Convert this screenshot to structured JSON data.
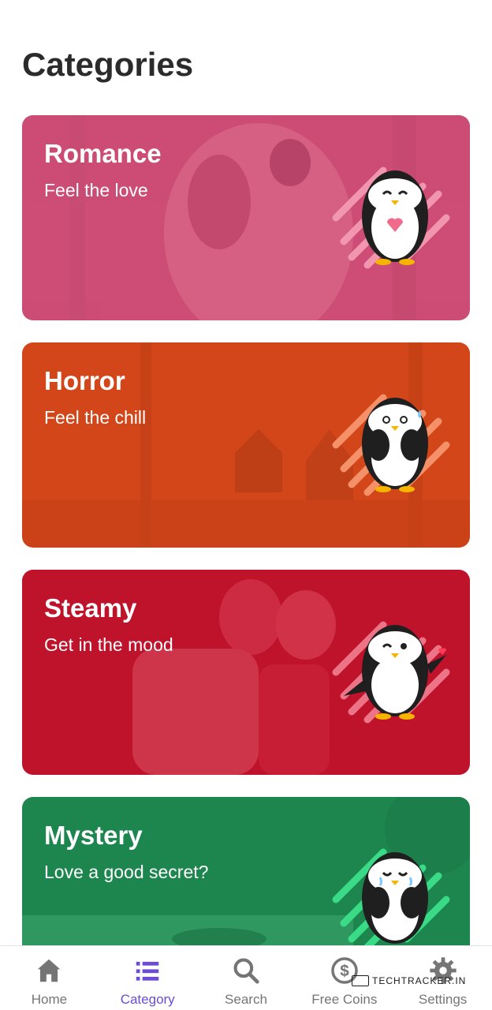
{
  "page": {
    "title": "Categories"
  },
  "categories": [
    {
      "title": "Romance",
      "subtitle": "Feel the love",
      "color": "#d2527a",
      "accent": "#f08aa8"
    },
    {
      "title": "Horror",
      "subtitle": "Feel the chill",
      "color": "#d94a1e",
      "accent": "#f07a52"
    },
    {
      "title": "Steamy",
      "subtitle": "Get in the mood",
      "color": "#c3142d",
      "accent": "#ef4e63"
    },
    {
      "title": "Mystery",
      "subtitle": "Love a good secret?",
      "color": "#1f8a52",
      "accent": "#3be089"
    }
  ],
  "nav": {
    "items": [
      {
        "label": "Home",
        "icon": "home-icon"
      },
      {
        "label": "Category",
        "icon": "list-icon",
        "active": true
      },
      {
        "label": "Search",
        "icon": "search-icon"
      },
      {
        "label": "Free Coins",
        "icon": "coin-icon"
      },
      {
        "label": "Settings",
        "icon": "gear-icon"
      }
    ],
    "active_color": "#6b4bd8",
    "inactive_color": "#757575"
  },
  "watermark": {
    "text": "TECHTRACKER.IN"
  }
}
